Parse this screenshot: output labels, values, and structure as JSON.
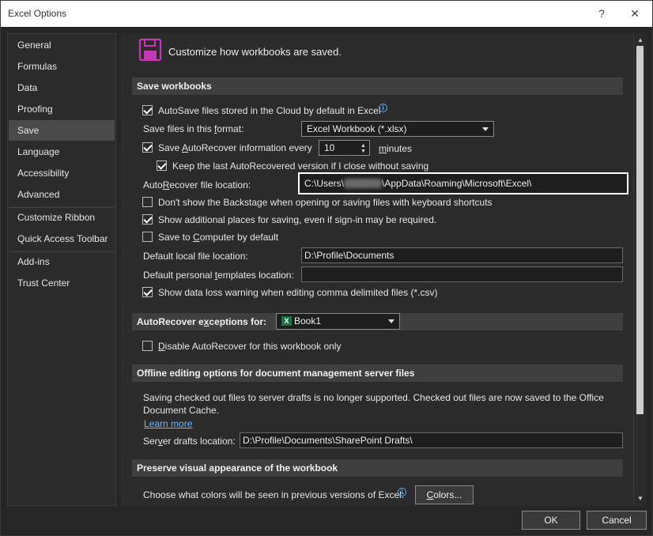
{
  "window": {
    "title": "Excel Options",
    "help_label": "?",
    "close_label": "✕"
  },
  "nav": {
    "items": [
      {
        "label": "General"
      },
      {
        "label": "Formulas"
      },
      {
        "label": "Data"
      },
      {
        "label": "Proofing"
      },
      {
        "label": "Save",
        "active": true
      },
      {
        "label": "Language"
      },
      {
        "label": "Accessibility"
      },
      {
        "label": "Advanced"
      },
      {
        "label": "Customize Ribbon"
      },
      {
        "label": "Quick Access Toolbar"
      },
      {
        "label": "Add-ins"
      },
      {
        "label": "Trust Center"
      }
    ]
  },
  "header": {
    "text": "Customize how workbooks are saved.",
    "icon": "save-icon"
  },
  "save_workbooks": {
    "title": "Save workbooks",
    "autosave": {
      "label": "AutoSave files stored in the Cloud by default in Excel",
      "checked": true
    },
    "format_label_prefix": "Save files in this ",
    "format_label_u": "f",
    "format_label_suffix": "ormat:",
    "format_value": "Excel Workbook (*.xlsx)",
    "autorecover": {
      "label_prefix": "Save ",
      "label_u": "A",
      "label_suffix": "utoRecover information every",
      "checked": true
    },
    "autorecover_minutes": "10",
    "minutes_label": "minutes",
    "keep_last": {
      "label": "Keep the last AutoRecovered version if I close without saving",
      "checked": true
    },
    "ar_location_label_prefix": "Auto",
    "ar_location_label_u": "R",
    "ar_location_label_suffix": "ecover file location:",
    "ar_location_value_prefix": "C:\\Users\\",
    "ar_location_value_suffix": "\\AppData\\Roaming\\Microsoft\\Excel\\",
    "backstage": {
      "label": "Don't show the Backstage when opening or saving files with keyboard shortcuts",
      "checked": false
    },
    "additional_places": {
      "label": "Show additional places for saving, even if sign-in may be required.",
      "checked": true
    },
    "save_to_computer": {
      "label_prefix": "Save to ",
      "label_u": "C",
      "label_suffix": "omputer by default",
      "checked": false
    },
    "default_local_label": "Default local file location:",
    "default_local_value": "D:\\Profile\\Documents",
    "templates_label_prefix": "Default personal ",
    "templates_label_u": "t",
    "templates_label_suffix": "emplates location:",
    "templates_value": "",
    "data_loss": {
      "label": "Show data loss warning when editing comma delimited files (*.csv)",
      "checked": true
    }
  },
  "exceptions": {
    "title_prefix": "AutoRecover e",
    "title_u": "x",
    "title_suffix": "ceptions for:",
    "workbook": "Book1",
    "disable": {
      "label_prefix": "",
      "label_u": "D",
      "label_suffix": "isable AutoRecover for this workbook only",
      "checked": false
    }
  },
  "offline": {
    "title": "Offline editing options for document management server files",
    "notice": "Saving checked out files to server drafts is no longer supported. Checked out files are now saved to the Office Document Cache.",
    "learn_more": "Learn more",
    "drafts_label_prefix": "Ser",
    "drafts_label_u": "v",
    "drafts_label_suffix": "er drafts location:",
    "drafts_value": "D:\\Profile\\Documents\\SharePoint Drafts\\"
  },
  "preserve": {
    "title": "Preserve visual appearance of the workbook",
    "colors_label": "Choose what colors will be seen in previous versions of Excel:",
    "colors_button_u": "C",
    "colors_button_suffix": "olors..."
  },
  "footer": {
    "ok": "OK",
    "cancel": "Cancel"
  }
}
